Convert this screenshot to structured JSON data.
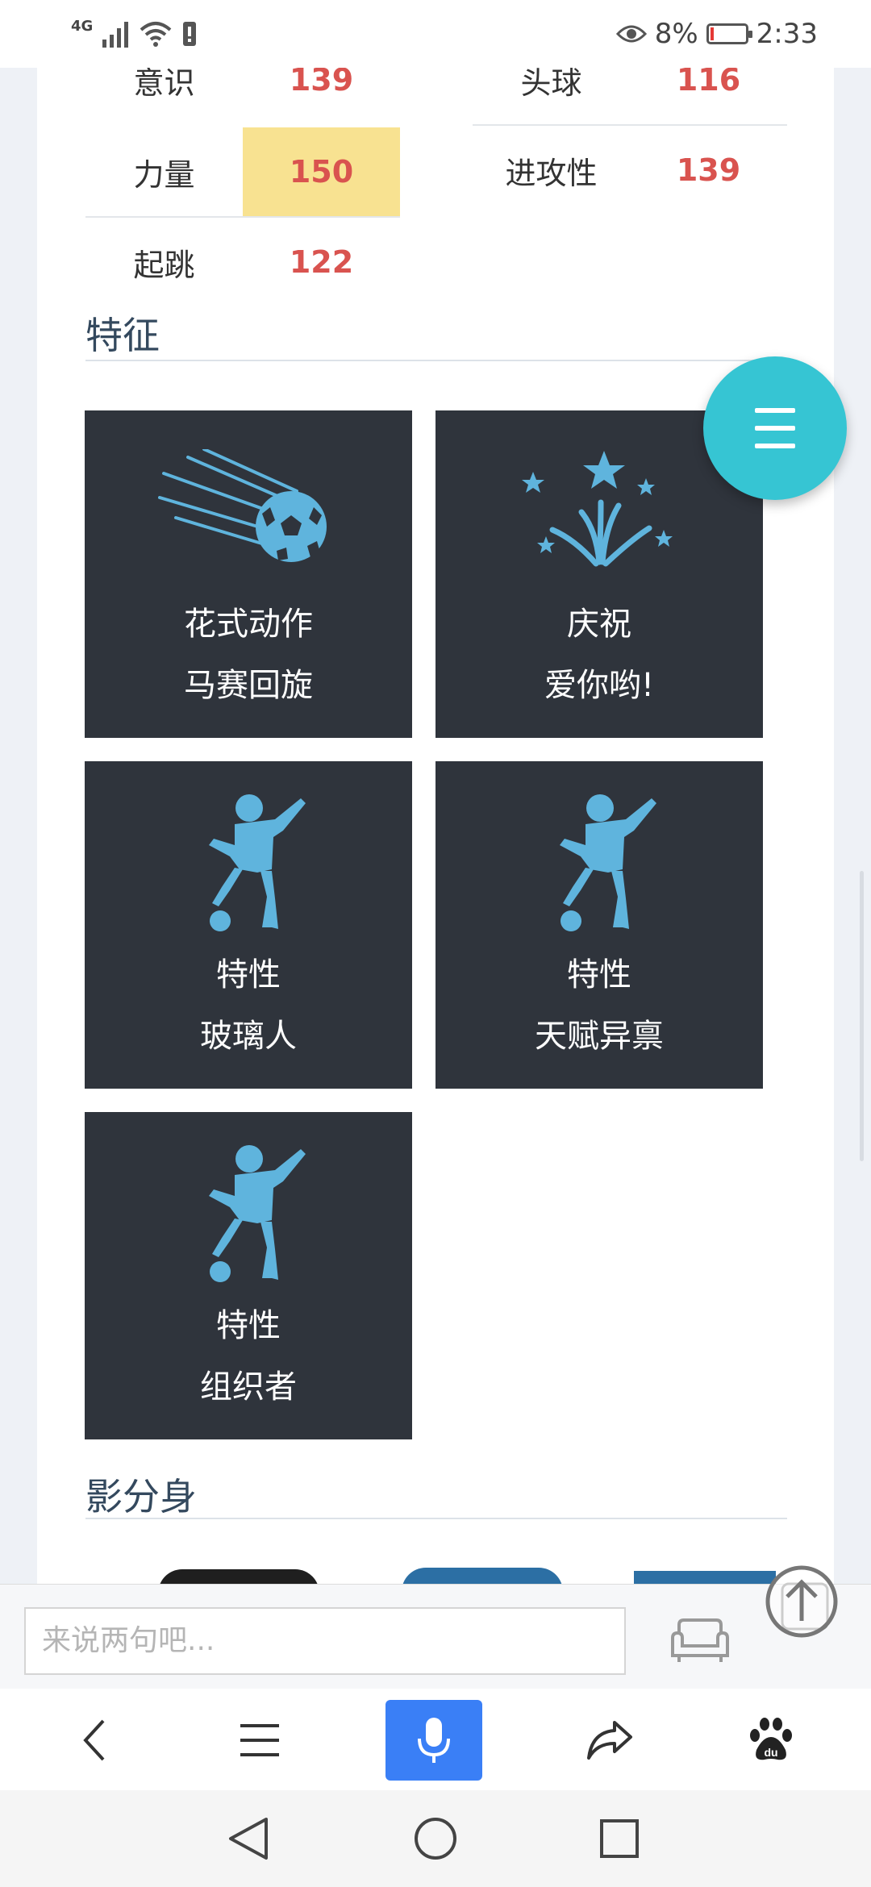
{
  "status_bar": {
    "network": "4G",
    "battery_percent": "8%",
    "time": "2:33",
    "battery_level": 0.08
  },
  "attributes": [
    {
      "label": "意识",
      "value": "139"
    },
    {
      "label": "头球",
      "value": "116"
    },
    {
      "label": "力量",
      "value": "150"
    },
    {
      "label": "进攻性",
      "value": "139"
    },
    {
      "label": "起跳",
      "value": "122"
    }
  ],
  "sections": {
    "traits_title": "特征",
    "shadow_title": "影分身"
  },
  "traits": [
    {
      "icon": "soccer-ball-icon",
      "line1": "花式动作",
      "line2": "马赛回旋"
    },
    {
      "icon": "fireworks-icon",
      "line1": "庆祝",
      "line2": "爱你哟!"
    },
    {
      "icon": "player-kick-icon",
      "line1": "特性",
      "line2": "玻璃人"
    },
    {
      "icon": "player-kick-icon",
      "line1": "特性",
      "line2": "天赋异禀"
    },
    {
      "icon": "player-kick-icon",
      "line1": "特性",
      "line2": "组织者"
    }
  ],
  "comment_bar": {
    "placeholder": "来说两句吧..."
  },
  "toolbar": {
    "items": [
      "back-icon",
      "menu-icon",
      "microphone-icon",
      "share-icon",
      "baidu-icon"
    ]
  },
  "navbar": {
    "items": [
      "nav-back-icon",
      "nav-home-icon",
      "nav-recents-icon"
    ]
  },
  "colors": {
    "accent": "#36c5d3",
    "value_red": "#d9534f",
    "highlight": "#f8e291",
    "tile_bg": "#2f343c",
    "mic_blue": "#3a7ff6"
  }
}
